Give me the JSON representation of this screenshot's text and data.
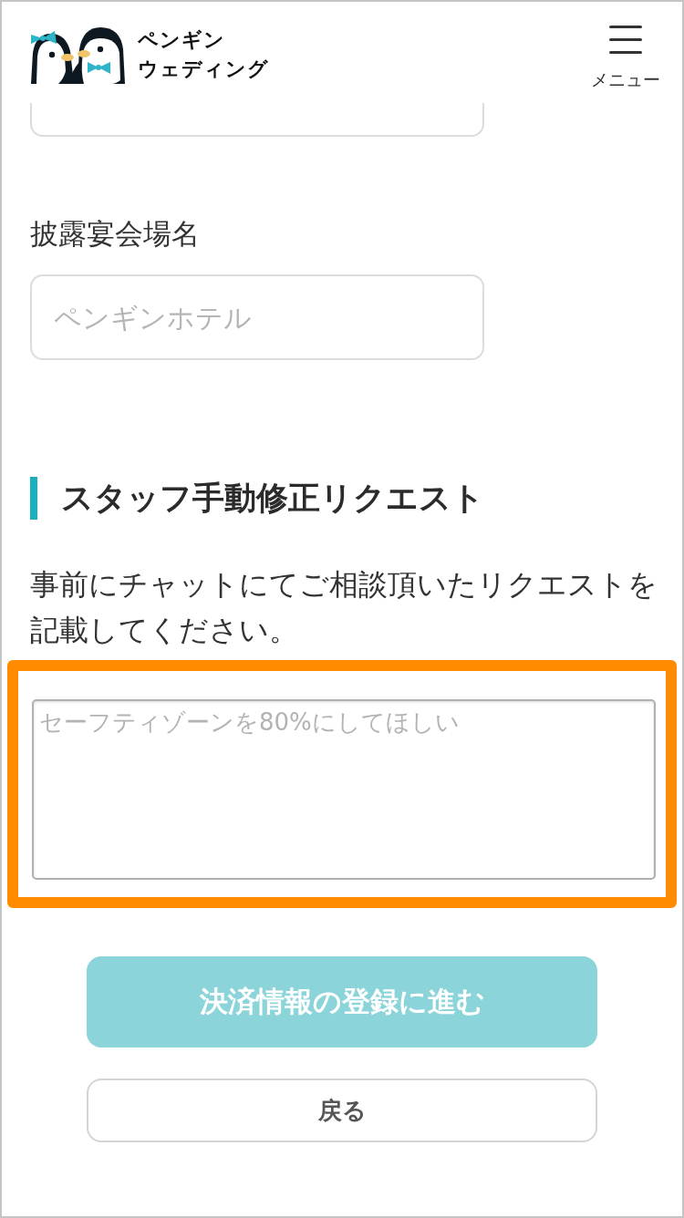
{
  "header": {
    "logo_text": [
      "ペンギン",
      "ウェディング"
    ],
    "menu_label": "メニュー"
  },
  "fields": [
    {
      "kind": "clipped"
    },
    {
      "kind": "text",
      "label": "披露宴会場名",
      "placeholder": "ペンギンホテル"
    }
  ],
  "request": {
    "title": "スタッフ手動修正リクエスト",
    "description": "事前にチャットにてご相談頂いたリクエストを記載してください。",
    "textarea": {
      "placeholder": "セーフティゾーンを80%にしてほしい",
      "highlighted": true
    }
  },
  "buttons": [
    {
      "kind": "primary",
      "label": "決済情報の登録に進む",
      "disabled": true
    },
    {
      "kind": "secondary",
      "label": "戻る"
    }
  ]
}
